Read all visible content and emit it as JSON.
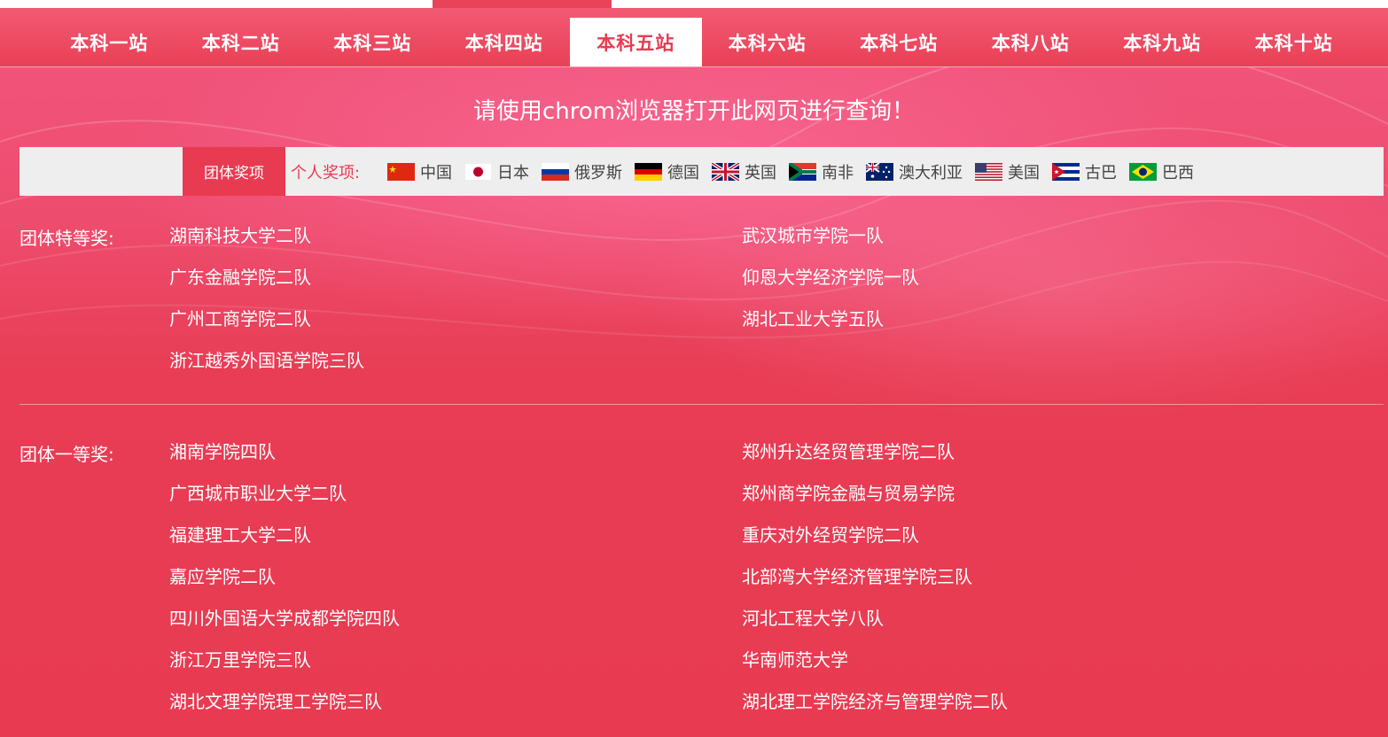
{
  "nav": {
    "items": [
      "本科一站",
      "本科二站",
      "本科三站",
      "本科四站",
      "本科五站",
      "本科六站",
      "本科七站",
      "本科八站",
      "本科九站",
      "本科十站"
    ],
    "active_index": 4
  },
  "notice": "请使用chrom浏览器打开此网页进行查询！",
  "filter": {
    "team_tab": "团体奖项",
    "personal_label": "个人奖项:",
    "countries": [
      {
        "name": "中国",
        "flag": "cn-flag-icon"
      },
      {
        "name": "日本",
        "flag": "jp-flag-icon"
      },
      {
        "name": "俄罗斯",
        "flag": "ru-flag-icon"
      },
      {
        "name": "德国",
        "flag": "de-flag-icon"
      },
      {
        "name": "英国",
        "flag": "gb-flag-icon"
      },
      {
        "name": "南非",
        "flag": "za-flag-icon"
      },
      {
        "name": "澳大利亚",
        "flag": "au-flag-icon"
      },
      {
        "name": "美国",
        "flag": "us-flag-icon"
      },
      {
        "name": "古巴",
        "flag": "cu-flag-icon"
      },
      {
        "name": "巴西",
        "flag": "br-flag-icon"
      }
    ]
  },
  "awards": {
    "special": {
      "label": "团体特等奖:",
      "left": [
        "湖南科技大学二队",
        "广东金融学院二队",
        "广州工商学院二队",
        "浙江越秀外国语学院三队"
      ],
      "right": [
        "武汉城市学院一队",
        "仰恩大学经济学院一队",
        "湖北工业大学五队"
      ]
    },
    "first": {
      "label": "团体一等奖:",
      "left": [
        "湘南学院四队",
        "广西城市职业大学二队",
        "福建理工大学二队",
        "嘉应学院二队",
        "四川外国语大学成都学院四队",
        "浙江万里学院三队",
        "湖北文理学院理工学院三队"
      ],
      "right": [
        "郑州升达经贸管理学院二队",
        "郑州商学院金融与贸易学院",
        "重庆对外经贸学院二队",
        "北部湾大学经济管理学院三队",
        "河北工程大学八队",
        "华南师范大学",
        "湖北理工学院经济与管理学院二队"
      ]
    }
  },
  "colors": {
    "brand": "#e83b52",
    "bar": "#eeeeee"
  }
}
